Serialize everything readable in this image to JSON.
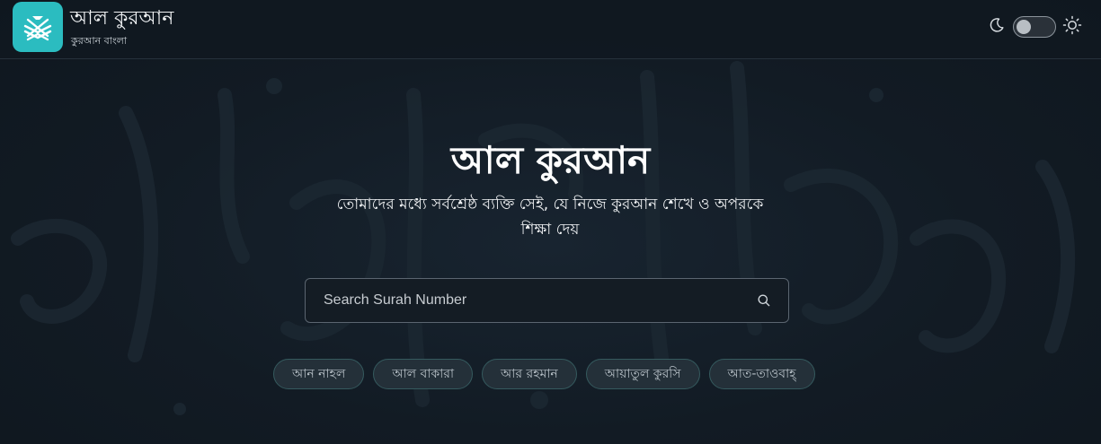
{
  "header": {
    "logo_icon": "quran-book-icon",
    "title": "আল কুরআন",
    "subtitle": "কুরআন বাংলা",
    "theme": {
      "dark_icon": "moon-icon",
      "light_icon": "sun-icon",
      "toggle_on": false
    }
  },
  "hero": {
    "title": "আল কুরআন",
    "subtitle": "তোমাদের মধ্যে সর্বশ্রেষ্ঠ ব্যক্তি সেই, যে নিজে কুরআন শেখে ও অপরকে শিক্ষা দেয়"
  },
  "search": {
    "placeholder": "Search Surah Number",
    "value": "",
    "icon": "search-icon"
  },
  "quick_links": [
    {
      "label": "আন নাহল"
    },
    {
      "label": "আল বাকারা"
    },
    {
      "label": "আর রহমান"
    },
    {
      "label": "আয়াতুল কুরসি"
    },
    {
      "label": "আত-তাওবাহ্‌"
    }
  ],
  "colors": {
    "background": "#111a22",
    "accent": "#2bbcc0",
    "chip_border": "#355a5e"
  }
}
